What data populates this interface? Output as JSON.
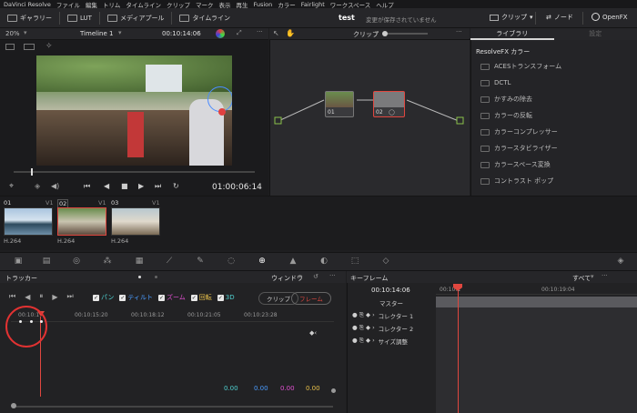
{
  "menu": [
    "DaVinci Resolve",
    "ファイル",
    "編集",
    "トリム",
    "タイムライン",
    "クリップ",
    "マーク",
    "表示",
    "再生",
    "Fusion",
    "カラー",
    "Fairlight",
    "ワークスペース",
    "ヘルプ"
  ],
  "toolbar": {
    "gallery": "ギャラリー",
    "lut": "LUT",
    "media_pool": "メディアプール",
    "timeline": "タイムライン",
    "project": "test",
    "unsaved": "変更が保存されていません",
    "clip": "クリップ",
    "node": "ノード",
    "openfx": "OpenFX"
  },
  "viewer": {
    "zoom": "20%",
    "timeline_name": "Timeline 1",
    "timecode_top": "00:10:14:06",
    "timecode": "01:00:06:14"
  },
  "nodes": {
    "mode": "クリップ",
    "node1": "01",
    "node2": "02"
  },
  "library": {
    "tab_library": "ライブラリ",
    "tab_settings": "設定",
    "title": "ResolveFX カラー",
    "items": [
      "ACESトランスフォーム",
      "DCTL",
      "かすみの除去",
      "カラーの反転",
      "カラーコンプレッサー",
      "カラースタビライザー",
      "カラースペース変換",
      "コントラスト ポップ"
    ]
  },
  "clips": [
    {
      "num": "01",
      "track": "V1",
      "codec": "H.264"
    },
    {
      "num": "02",
      "track": "V1",
      "codec": "H.264"
    },
    {
      "num": "03",
      "track": "V1",
      "codec": "H.264"
    }
  ],
  "tracker": {
    "title": "トラッカー",
    "window": "ウィンドウ",
    "pan": "パン",
    "tilt": "ティルト",
    "zoom": "ズーム",
    "rotate": "回転",
    "three_d": "3D",
    "clip_btn": "クリップ",
    "frame_btn": "フレーム",
    "ruler": [
      "00:10:1",
      "00:10:15:20",
      "00:10:18:12",
      "00:10:21:05",
      "00:10:23:28"
    ],
    "values": [
      "0.00",
      "0.00",
      "0.00",
      "0.00"
    ]
  },
  "keyframes": {
    "title": "キーフレーム",
    "filter": "すべて",
    "timecode": "00:10:14:06",
    "ruler": [
      "00:10:1",
      "00:10:19:04"
    ],
    "rows": [
      "マスター",
      "コレクター 1",
      "コレクター 2",
      "サイズ調整"
    ]
  },
  "colors": {
    "accent_red": "#e0473f",
    "pan": "#4fd0d0",
    "tilt": "#4a9cff",
    "zoom": "#e050d0",
    "rotate": "#e8c04a"
  }
}
